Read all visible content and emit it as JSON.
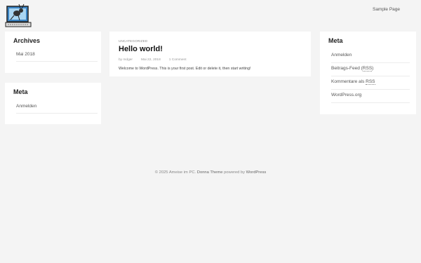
{
  "header": {
    "nav": [
      {
        "label": "Sample Page"
      }
    ]
  },
  "sidebar_left": {
    "archives": {
      "title": "Archives",
      "items": [
        {
          "label": "Mai 2018"
        }
      ]
    },
    "meta": {
      "title": "Meta",
      "items": [
        {
          "label": "Anmelden"
        }
      ]
    }
  },
  "post": {
    "category": "UNCATEGORIZED",
    "title": "Hello world!",
    "author": "by mdger",
    "date": "Mai 22, 2018",
    "comments": "1 Comment",
    "excerpt": "Welcome to WordPress. This is your first post. Edit or delete it, then start writing!"
  },
  "sidebar_right": {
    "meta": {
      "title": "Meta",
      "items": [
        {
          "pre": "Anmelden",
          "abbr": "",
          "post": ""
        },
        {
          "pre": "Beitrags-Feed (",
          "abbr": "RSS",
          "post": ")"
        },
        {
          "pre": "Kommentare als ",
          "abbr": "RSS",
          "post": ""
        },
        {
          "pre": "WordPress.org",
          "abbr": "",
          "post": ""
        }
      ]
    }
  },
  "footer": {
    "copyright": "© 2025 Ameise im PC",
    "sep": ".",
    "theme_link": "Donna Theme",
    "powered_by": "powered by",
    "wp_link": "WordPress"
  },
  "logo": {
    "icon": "ant-at-computer-logo"
  }
}
